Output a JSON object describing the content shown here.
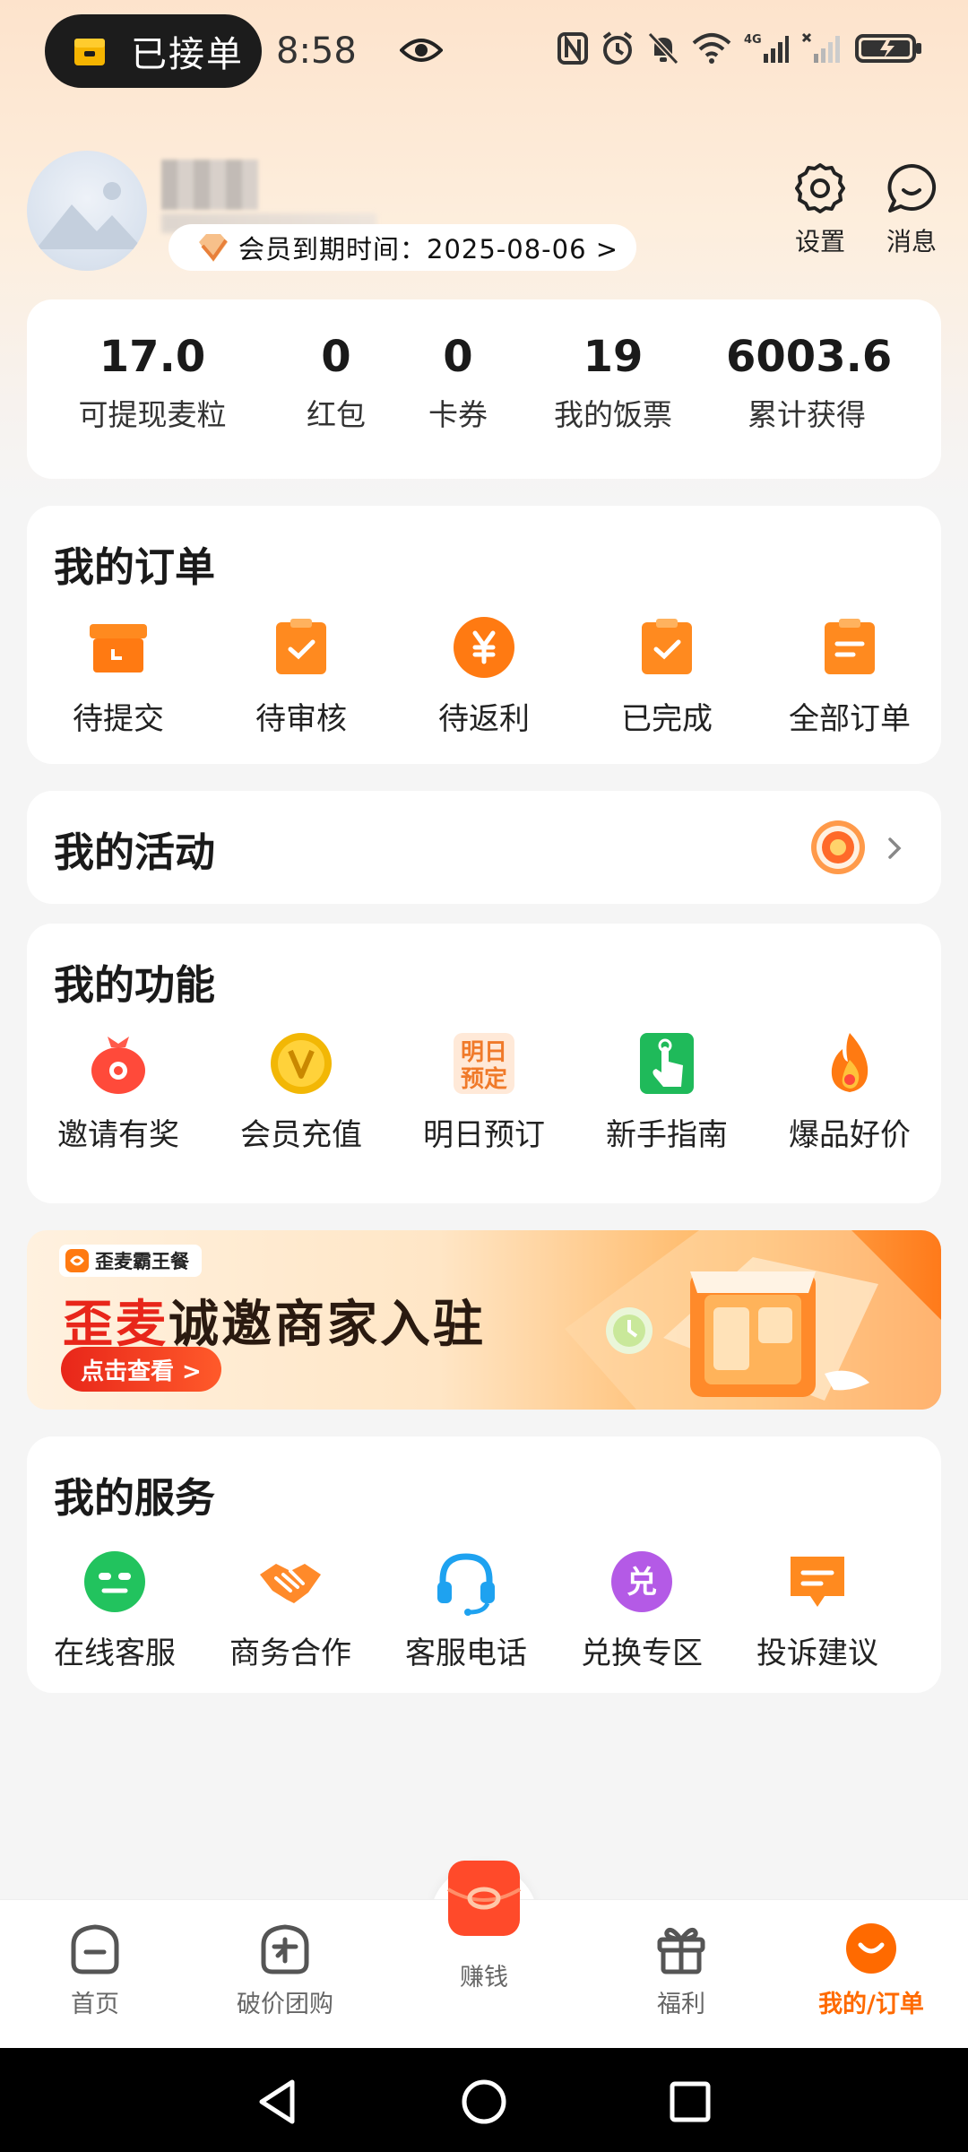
{
  "status_bar": {
    "pill_text": "已接单",
    "time": "8:58"
  },
  "profile": {
    "vip_expiry": "会员到期时间：2025-08-06 >",
    "settings_label": "设置",
    "messages_label": "消息"
  },
  "stats": [
    {
      "value": "17.0",
      "label": "可提现麦粒"
    },
    {
      "value": "0",
      "label": "红包"
    },
    {
      "value": "0",
      "label": "卡券"
    },
    {
      "value": "19",
      "label": "我的饭票"
    },
    {
      "value": "6003.6",
      "label": "累计获得"
    }
  ],
  "orders": {
    "title": "我的订单",
    "items": [
      {
        "label": "待提交",
        "icon": "box-icon"
      },
      {
        "label": "待审核",
        "icon": "clipboard-check-icon"
      },
      {
        "label": "待返利",
        "icon": "yen-coin-icon"
      },
      {
        "label": "已完成",
        "icon": "clipboard-done-icon"
      },
      {
        "label": "全部订单",
        "icon": "clipboard-list-icon"
      }
    ]
  },
  "activity": {
    "title": "我的活动"
  },
  "functions": {
    "title": "我的功能",
    "items": [
      {
        "label": "邀请有奖",
        "icon": "money-bag-icon"
      },
      {
        "label": "会员充值",
        "icon": "vip-coin-icon"
      },
      {
        "label": "明日预订",
        "icon": "tomorrow-booking-icon",
        "icon_text_1": "明日",
        "icon_text_2": "预定"
      },
      {
        "label": "新手指南",
        "icon": "tap-guide-icon"
      },
      {
        "label": "爆品好价",
        "icon": "flame-icon"
      }
    ]
  },
  "banner": {
    "brand": "歪麦霸王餐",
    "headline_a": "歪麦",
    "headline_b": "诚邀商家入驻",
    "cta": "点击查看 >"
  },
  "services": {
    "title": "我的服务",
    "items": [
      {
        "label": "在线客服",
        "icon": "online-service-icon"
      },
      {
        "label": "商务合作",
        "icon": "handshake-icon"
      },
      {
        "label": "客服电话",
        "icon": "headset-icon"
      },
      {
        "label": "兑换专区",
        "icon": "exchange-icon",
        "icon_text": "兑"
      },
      {
        "label": "投诉建议",
        "icon": "feedback-icon"
      }
    ]
  },
  "bottom_nav": {
    "items": [
      {
        "label": "首页"
      },
      {
        "label": "破价团购"
      },
      {
        "label": "赚钱"
      },
      {
        "label": "福利"
      },
      {
        "label": "我的/订单"
      }
    ],
    "active_index": 4
  },
  "colors": {
    "accent": "#ff6a00",
    "orange_icon": "#ff8a1f"
  }
}
